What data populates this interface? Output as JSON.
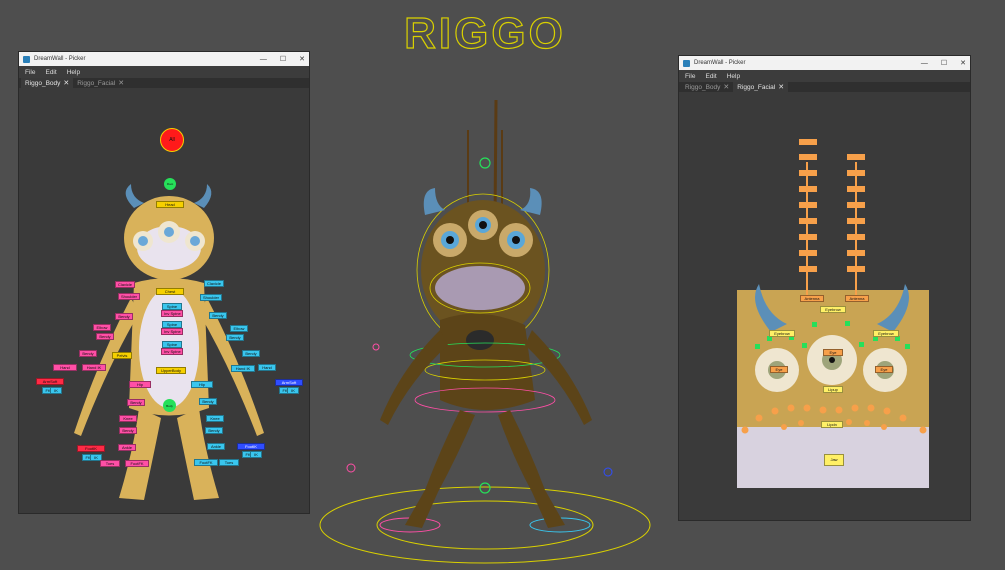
{
  "logo_text": "RIGGO",
  "window_title": "DreamWall - Picker",
  "window_controls": {
    "minimize": "—",
    "maximize": "☐",
    "close": "✕"
  },
  "menu": [
    "File",
    "Edit",
    "Help"
  ],
  "tabs": [
    {
      "label": "Riggo_Body",
      "close": "✕"
    },
    {
      "label": "Riggo_Facial",
      "close": "✕"
    }
  ],
  "colors": {
    "background": "#4e4e4e",
    "panel": "#3a3a3a",
    "yellow": "#f6d000",
    "pink": "#ff4fa6",
    "cyan": "#39c6ee",
    "red": "#ff2a45",
    "blue": "#2f4dff",
    "orange": "#f7a04a",
    "green": "#26e05a"
  },
  "body_picker": {
    "all_button": "All",
    "root_button": "Root",
    "body_button": "Body",
    "labels": {
      "head": "Head",
      "chest": "Chest",
      "spine1": "Spine",
      "inv_spine1": "Inv Spine",
      "spine2": "Spine",
      "inv_spine2": "Inv Spine",
      "spine3": "Spine",
      "inv_spine3": "Inv Spine",
      "pelvis": "Pelvis",
      "upperbody": "UpperBody",
      "clavicle_r": "Clavicle",
      "clavicle_l": "Clavicle",
      "shoulder_r": "Shoulder",
      "shoulder_l": "Shoulder",
      "bendy_r1": "Bendy",
      "bendy_l1": "Bendy",
      "elbow_r": "Elbow",
      "elbow_l": "Elbow",
      "bendy_r2": "Bendy",
      "bendy_l2": "Bendy",
      "bendy_r3": "Bendy",
      "bendy_l3": "Bendy",
      "hand_r": "Hand",
      "hand_ik_r": "Hand IK",
      "hand_fk_r": "Hand FK",
      "hand_ik_l": "Hand IK",
      "hand_l": "Hand",
      "armsoft_r": "ArmSoft",
      "armsoft_l": "ArmSoft",
      "fk_r": "FK",
      "ik_r": "IK",
      "fk_l": "FK",
      "ik_l": "IK",
      "hip_r": "Hip",
      "hip_l": "Hip",
      "bendy_r4": "Bendy",
      "bendy_l4": "Bendy",
      "knee_r": "Knee",
      "knee_l": "Knee",
      "bendy_r5": "Bendy",
      "bendy_l5": "Bendy",
      "ankle_r": "Ankle",
      "ankle_l": "Ankle",
      "footik_r": "FootIK",
      "footik_l": "FootIK",
      "legsoft_r": "LegSoft",
      "legsoft_l": "LegSoft",
      "fk_r2": "FK",
      "ik_r2": "IK",
      "fk_l2": "FK",
      "ik_l2": "IK",
      "toes_r": "Toes",
      "toes_l": "Toes",
      "footfk_r": "FootFK",
      "footfk_l": "FootFK"
    }
  },
  "facial_picker": {
    "labels": {
      "antenna_r": "Antenna",
      "antenna_l": "Antenna",
      "eyebrow_c": "Eyebrow",
      "eyebrow_r": "Eyebrow",
      "eyebrow_l": "Eyebrow",
      "eye_c": "Eye",
      "eye_r": "Eye",
      "eye_l": "Eye",
      "lipup": "Lipup",
      "lipdown": "Lipdn",
      "jaw": "Jaw"
    }
  }
}
